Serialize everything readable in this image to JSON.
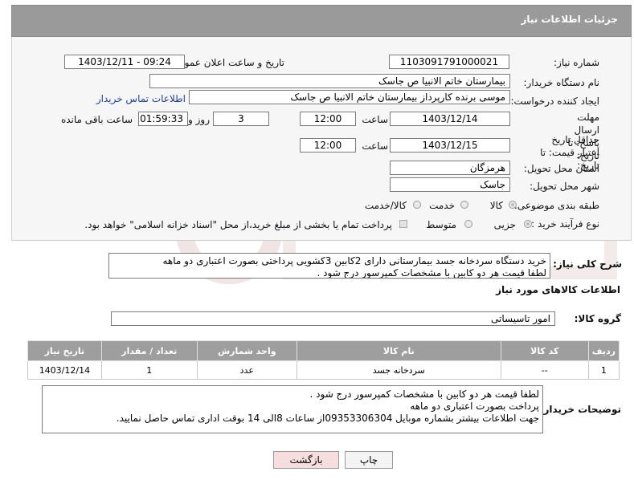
{
  "header": {
    "title": "جزئیات اطلاعات نیاز"
  },
  "form": {
    "need_number_label": "شماره نیاز:",
    "need_number": "1103091791000021",
    "announce_label": "تاریخ و ساعت اعلان عمومی:",
    "announce_value": "1403/12/11 - 09:24",
    "buyer_org_label": "نام دستگاه خریدار:",
    "buyer_org": "بیمارستان خاتم الانبیا  ص  جاسک",
    "creator_label": "ایجاد کننده درخواست:",
    "creator": "موسی  برنده کارپرداز بیمارستان خاتم الانبیا  ص  جاسک",
    "contact_link": "اطلاعات تماس خریدار",
    "deadline_label": "مهلت ارسال پاسخ: تا تاریخ:",
    "deadline_date": "1403/12/14",
    "time_label": "ساعت",
    "deadline_time": "12:00",
    "days_value": "3",
    "days_label": "روز و",
    "remaining_value": "01:59:33",
    "remaining_label": "ساعت باقی مانده",
    "price_validity_label": "حداقل تاریخ اعتبار قیمت: تا تاریخ:",
    "price_validity_date": "1403/12/15",
    "price_validity_time": "12:00",
    "province_label": "استان محل تحویل:",
    "province": "هرمزگان",
    "city_label": "شهر محل تحویل:",
    "city": "جاسک",
    "category_label": "طبقه بندی موضوعی:",
    "category_options": [
      "کالا",
      "خدمت",
      "کالا/خدمت"
    ],
    "purchase_type_label": "نوع فرآیند خرید :",
    "purchase_type_options": [
      "جزیی",
      "متوسط"
    ],
    "payment_note": "پرداخت تمام یا بخشی از مبلغ خرید،از محل \"اسناد خزانه اسلامی\" خواهد بود."
  },
  "description": {
    "label": "شرح کلی نیاز:",
    "line1": "خرید دستگاه سردخانه جسد بیمارستانی دارای 2کابین 3کشویی پرداختی بصورت اعتباری دو ماهه",
    "line2": "لطفا قیمت هر دو کابین  با مشخصات کمپرسور درج شود ."
  },
  "goods": {
    "section_title": "اطلاعات کالاهای مورد نیاز",
    "group_label": "گروه کالا:",
    "group_value": "امور تاسیساتی",
    "columns": [
      "ردیف",
      "کد کالا",
      "نام کالا",
      "واحد شمارش",
      "تعداد / مقدار",
      "تاریخ نیاز"
    ],
    "rows": [
      {
        "row": "1",
        "code": "--",
        "name": "سردخانه جسد",
        "unit": "عدد",
        "qty": "1",
        "date": "1403/12/14"
      }
    ]
  },
  "buyer_notes": {
    "label": "توضیحات خریدار:",
    "line1": "لطفا قیمت هر دو کابین  با مشخصات کمپرسور درج شود .",
    "line2": "پرداخت بصورت اعتباری دو ماهه",
    "line3": "جهت اطلاعات بیشتر بشماره موبایل 09353306304از ساعات 8الی 14 بوقت اداری تماس حاصل نمایید."
  },
  "buttons": {
    "print": "چاپ",
    "back": "بازگشت"
  },
  "colors": {
    "header_bg": "#9a9a9a",
    "link": "#1f3f9a",
    "back_button_bg": "#f7dede"
  }
}
